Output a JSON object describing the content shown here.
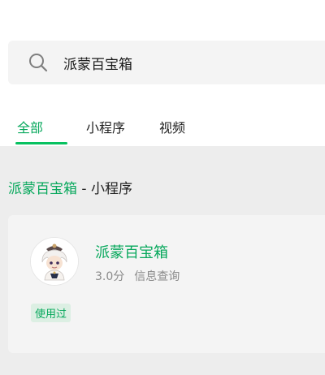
{
  "search": {
    "query": "派蒙百宝箱"
  },
  "tabs": [
    {
      "label": "全部",
      "active": true
    },
    {
      "label": "小程序",
      "active": false
    },
    {
      "label": "视频",
      "active": false
    }
  ],
  "section": {
    "title_highlight": "派蒙百宝箱",
    "title_rest": " - 小程序"
  },
  "result": {
    "name": "派蒙百宝箱",
    "rating": "3.0分",
    "category": "信息查询",
    "badge": "使用过"
  },
  "colors": {
    "accent": "#07c160",
    "accent_text": "#07a85c",
    "background": "#ededed"
  },
  "icons": {
    "search": "search-icon",
    "avatar": "app-avatar-icon"
  }
}
